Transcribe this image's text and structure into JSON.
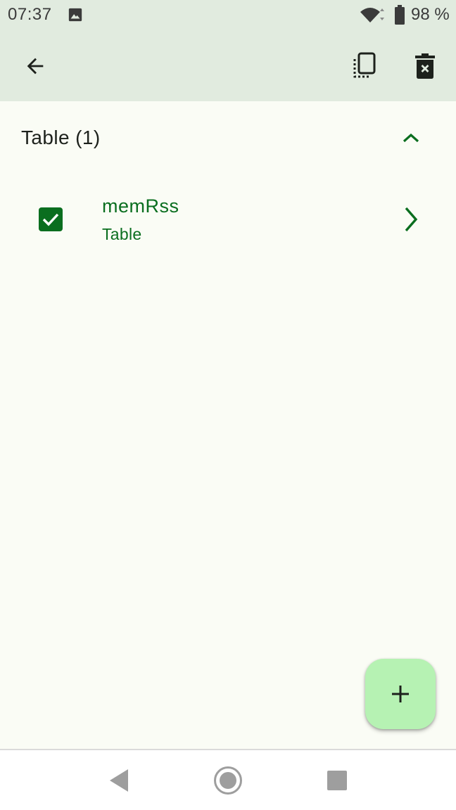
{
  "status_bar": {
    "time": "07:37",
    "battery": "98 %",
    "icons": [
      "image-icon",
      "wifi-icon",
      "battery-icon"
    ]
  },
  "app_bar": {
    "icons": [
      "arrow-back-icon",
      "copy-icon",
      "delete-icon"
    ]
  },
  "section": {
    "title": "Table (1)",
    "expanded": true
  },
  "items": [
    {
      "title": "memRss",
      "subtitle": "Table",
      "checked": true
    }
  ],
  "fab": {
    "icon": "plus-icon"
  },
  "colors": {
    "accent": "#0a6e1f",
    "bar_background": "#e1ebdf",
    "page_background": "#fafcf5",
    "fab_background": "#b6f2b3"
  }
}
